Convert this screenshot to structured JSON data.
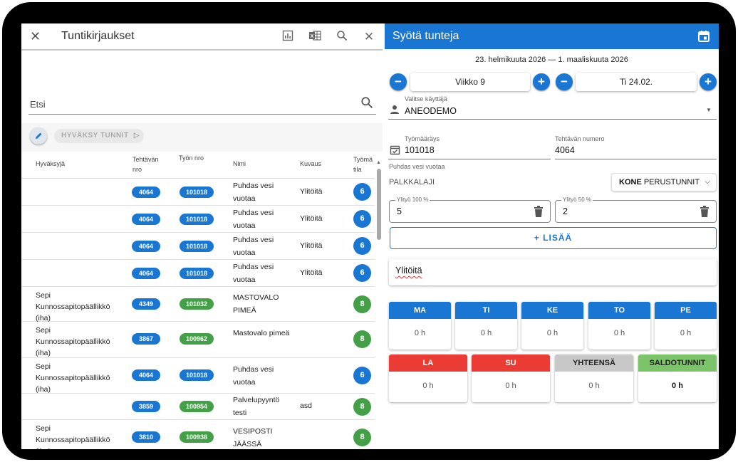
{
  "left": {
    "title": "Tuntikirjaukset",
    "search_placeholder": "Etsi",
    "approve_label": "HYVÄKSY TUNNIT",
    "columns": {
      "approver": "Hyväksyjä",
      "task_no": "Tehtävän nro",
      "work_no": "Työn nro",
      "name": "Nimi",
      "desc": "Kuvaus",
      "status": "Työmä tila"
    },
    "rows": [
      {
        "approver": "",
        "task": "4064",
        "work": "101018",
        "name": "Puhdas vesi vuotaa",
        "desc": "Ylitöitä",
        "status": "6",
        "color": "blue"
      },
      {
        "approver": "",
        "task": "4064",
        "work": "101018",
        "name": "Puhdas vesi vuotaa",
        "desc": "Ylitöitä",
        "status": "6",
        "color": "blue"
      },
      {
        "approver": "",
        "task": "4064",
        "work": "101018",
        "name": "Puhdas vesi vuotaa",
        "desc": "Ylitöitä",
        "status": "6",
        "color": "blue"
      },
      {
        "approver": "",
        "task": "4064",
        "work": "101018",
        "name": "Puhdas vesi vuotaa",
        "desc": "Ylitöitä",
        "status": "6",
        "color": "blue"
      },
      {
        "approver": "Sepi Kunnossapitopäällikkö (iha)",
        "task": "4349",
        "work": "101032",
        "name": "MASTOVALO PIMEÄ",
        "desc": "",
        "status": "8",
        "color": "green"
      },
      {
        "approver": "Sepi Kunnossapitopäällikkö (iha)",
        "task": "3867",
        "work": "100962",
        "name": "Mastovalo pimeä",
        "desc": "",
        "status": "8",
        "color": "green"
      },
      {
        "approver": "Sepi Kunnossapitopäällikkö (iha)",
        "task": "4064",
        "work": "101018",
        "name": "Puhdas vesi vuotaa",
        "desc": "",
        "status": "6",
        "color": "blue"
      },
      {
        "approver": "",
        "task": "3859",
        "work": "100954",
        "name": "Palvelupyyntö testi",
        "desc": "asd",
        "status": "8",
        "color": "green"
      },
      {
        "approver": "Sepi Kunnossapitopäällikkö (iha)",
        "task": "3810",
        "work": "100938",
        "name": "VESIPOSTI JÄÄSSÄ",
        "desc": "",
        "status": "8",
        "color": "green"
      }
    ]
  },
  "right": {
    "title": "Syötä tunteja",
    "date_range": "23. helmikuuta 2026 — 1. maaliskuuta 2026",
    "week": "Viikko 9",
    "day": "Ti 24.02.",
    "user_label": "Valitse käyttäjä",
    "user_value": "ANEODEMO",
    "order_label": "Työmääräys",
    "order_value": "101018",
    "task_label": "Tehtävän numero",
    "task_value": "4064",
    "order_name": "Puhdas vesi vuotaa",
    "wage_type_label": "PALKKALAJI",
    "wage_type_bold": "KONE",
    "wage_type_value": "PERUSTUNNIT",
    "ot100_label": "Ylityö 100 %",
    "ot100_value": "5",
    "ot50_label": "Ylityö 50 %",
    "ot50_value": "2",
    "add_label": "+ LISÄÄ",
    "note": "Ylitöitä",
    "days_top": [
      {
        "label": "MA",
        "value": "0 h"
      },
      {
        "label": "TI",
        "value": "0 h"
      },
      {
        "label": "KE",
        "value": "0 h"
      },
      {
        "label": "TO",
        "value": "0 h"
      },
      {
        "label": "PE",
        "value": "0 h"
      }
    ],
    "days_bottom": [
      {
        "label": "LA",
        "value": "0 h",
        "color": "#ea3b35"
      },
      {
        "label": "SU",
        "value": "0 h",
        "color": "#ea3b35"
      },
      {
        "label": "YHTEENSÄ",
        "value": "0 h",
        "color": "#c8c8c8"
      },
      {
        "label": "SALDOTUNNIT",
        "value": "0 h",
        "color": "#7cc46a"
      }
    ]
  },
  "colors": {
    "primary": "#1976d2",
    "green": "#43a047",
    "red": "#ea3b35"
  }
}
